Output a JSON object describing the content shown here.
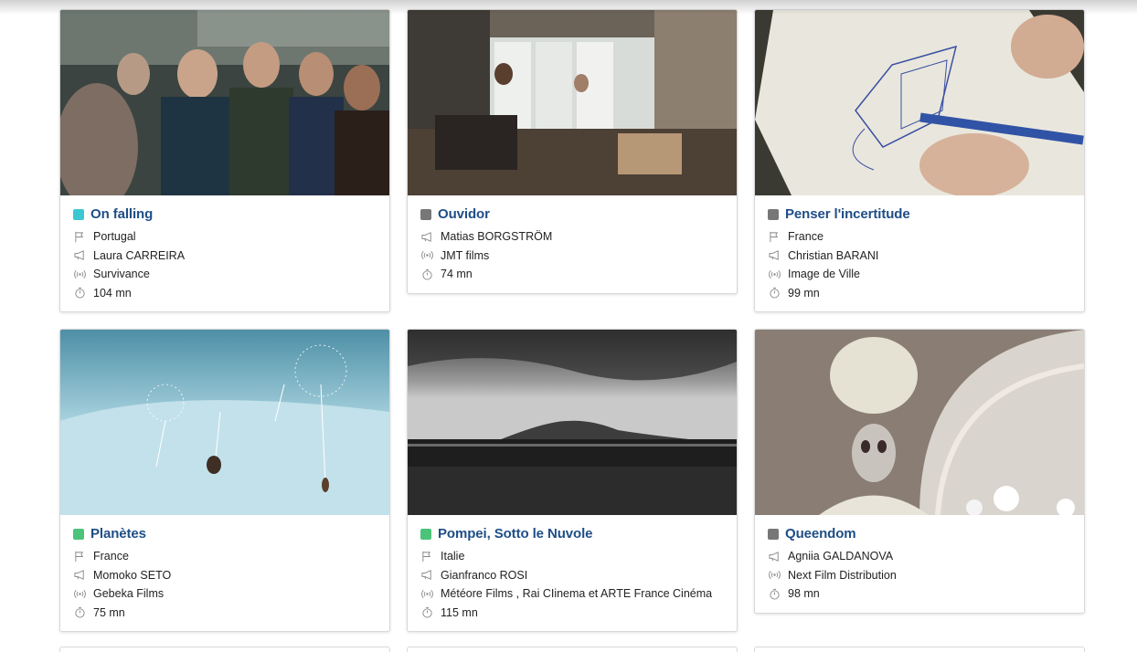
{
  "cards": [
    {
      "title": "On falling",
      "tag_color": "#3cc8d2",
      "country": "Portugal",
      "director": "Laura CARREIRA",
      "distributor": "Survivance",
      "duration": "104 mn"
    },
    {
      "title": "Ouvidor",
      "tag_color": "#777777",
      "director": "Matias BORGSTRÖM",
      "distributor": "JMT films",
      "duration": "74 mn"
    },
    {
      "title": "Penser l'incertitude",
      "tag_color": "#777777",
      "country": "France",
      "director": "Christian BARANI",
      "distributor": "Image de Ville",
      "duration": "99 mn"
    },
    {
      "title": "Planètes",
      "tag_color": "#4cc37a",
      "country": "France",
      "director": "Momoko SETO",
      "distributor": "Gebeka Films",
      "duration": "75 mn"
    },
    {
      "title": "Pompei, Sotto le Nuvole",
      "tag_color": "#4cc37a",
      "country": "Italie",
      "director": "Gianfranco ROSI",
      "distributor": "Météore Films , Rai CIinema et ARTE France Cinéma",
      "duration": "115 mn"
    },
    {
      "title": "Queendom",
      "tag_color": "#777777",
      "director": "Agniia GALDANOVA",
      "distributor": "Next Film Distribution",
      "duration": "98 mn"
    }
  ],
  "icons": {
    "country": "flag-icon",
    "director": "megaphone-icon",
    "distributor": "broadcast-icon",
    "duration": "stopwatch-icon"
  }
}
